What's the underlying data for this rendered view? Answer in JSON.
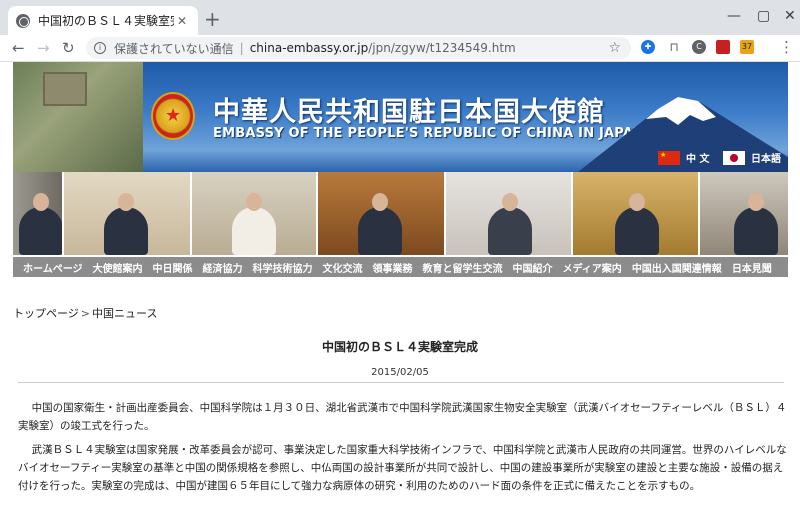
{
  "browser": {
    "tab_title": "中国初のＢＳＬ４実験室完成",
    "tab_close": "✕",
    "new_tab": "+",
    "window_controls": [
      "—",
      "▢",
      "✕"
    ],
    "security_label": "保護されていない通信",
    "separator": "|",
    "url_host": "china-embassy.or.jp",
    "url_path": "/jpn/zgyw/t1234549.htm",
    "extension_badge": "37"
  },
  "header": {
    "title_cn": "中華人民共和国駐日本国大使館",
    "title_en": "EMBASSY OF THE PEOPLE'S REPUBLIC OF CHINA IN JAPAN",
    "lang_cn": "中 文",
    "lang_jp": "日本語"
  },
  "nav": {
    "items": [
      "ホームページ",
      "大使館案内",
      "中日関係",
      "経済協力",
      "科学技術協力",
      "文化交流",
      "領事業務",
      "教育と留学生交流",
      "中国紹介",
      "メディア案内",
      "中国出入国関連情報",
      "日本見聞"
    ]
  },
  "breadcrumb": {
    "home": "トップページ",
    "separator": ">",
    "current": "中国ニュース"
  },
  "article": {
    "title": "中国初のＢＳＬ４実験室完成",
    "date": "2015/02/05",
    "paragraphs": [
      "中国の国家衛生・計画出産委員会、中国科学院は１月３０日、湖北省武漢市で中国科学院武漢国家生物安全実験室（武漢バイオセーフティーレベル（ＢＳＬ）４実験室）の竣工式を行った。",
      "武漢ＢＳＬ４実験室は国家発展・改革委員会が認可、事業決定した国家重大科学技術インフラで、中国科学院と武漢市人民政府の共同運営。世界のハイレベルなバイオセーフティー実験室の基準と中国の関係規格を参照し、中仏両国の設計事業所が共同で設計し、中国の建設事業所が実験室の建設と主要な施設・設備の据え付けを行った。実験室の完成は、中国が建国６５年目にして強力な病原体の研究・利用のためのハード面の条件を正式に備えたことを示すもの。"
    ]
  },
  "colors": {
    "nav_bg": "#8c8c8c",
    "banner_blue": "#1e5aa8",
    "chrome_tabstrip": "#dee1e6"
  }
}
